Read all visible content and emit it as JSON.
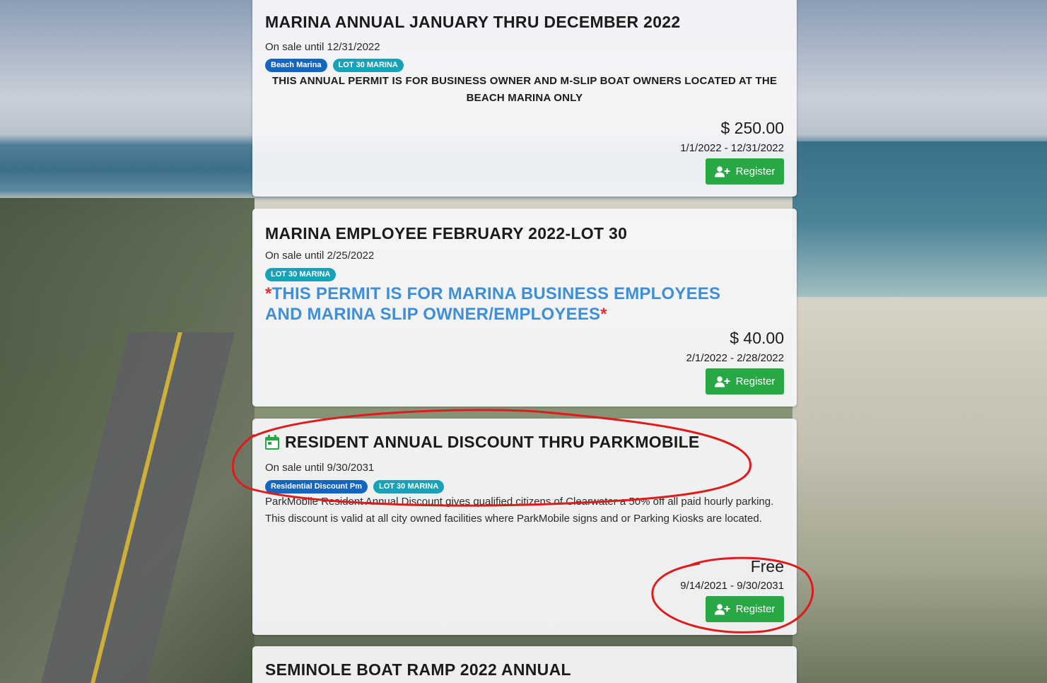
{
  "permits": [
    {
      "title": "MARINA ANNUAL JANUARY THRU DECEMBER 2022",
      "on_sale": "On sale until 12/31/2022",
      "badges": [
        "Beach Marina",
        "LOT 30 MARINA"
      ],
      "description": "THIS ANNUAL PERMIT IS FOR BUSINESS OWNER AND M-SLIP BOAT OWNERS LOCATED AT THE BEACH MARINA ONLY",
      "price": "$ 250.00",
      "dates": "1/1/2022 - 12/31/2022",
      "register_label": "Register"
    },
    {
      "title": "MARINA EMPLOYEE FEBRUARY 2022-LOT 30",
      "on_sale": "On sale until 2/25/2022",
      "badges": [
        "LOT 30 MARINA"
      ],
      "description_star": "*",
      "description": "THIS PERMIT IS FOR MARINA BUSINESS EMPLOYEES AND MARINA SLIP OWNER/EMPLOYEES",
      "price": "$ 40.00",
      "dates": "2/1/2022 - 2/28/2022",
      "register_label": "Register"
    },
    {
      "title": "RESIDENT ANNUAL DISCOUNT THRU PARKMOBILE",
      "icon": "calendar-icon",
      "on_sale": "On sale until 9/30/2031",
      "badges": [
        "Residential Discount Pm",
        "LOT 30 MARINA"
      ],
      "description": "ParkMobile Resident Annual Discount gives qualified citizens of Clearwater a 50% off all paid hourly parking.  This discount is valid at all city owned facilities where ParkMobile signs and or Parking Kiosks are located.",
      "price": "Free",
      "dates": "9/14/2021 - 9/30/2031",
      "register_label": "Register"
    },
    {
      "title": "SEMINOLE BOAT RAMP 2022 ANNUAL"
    }
  ],
  "colors": {
    "register_button": "#28a745",
    "badge_blue": "#1565c0",
    "badge_teal": "#17a2b8",
    "alert_text": "#3f8fd6",
    "annotation": "#e01b1b"
  }
}
